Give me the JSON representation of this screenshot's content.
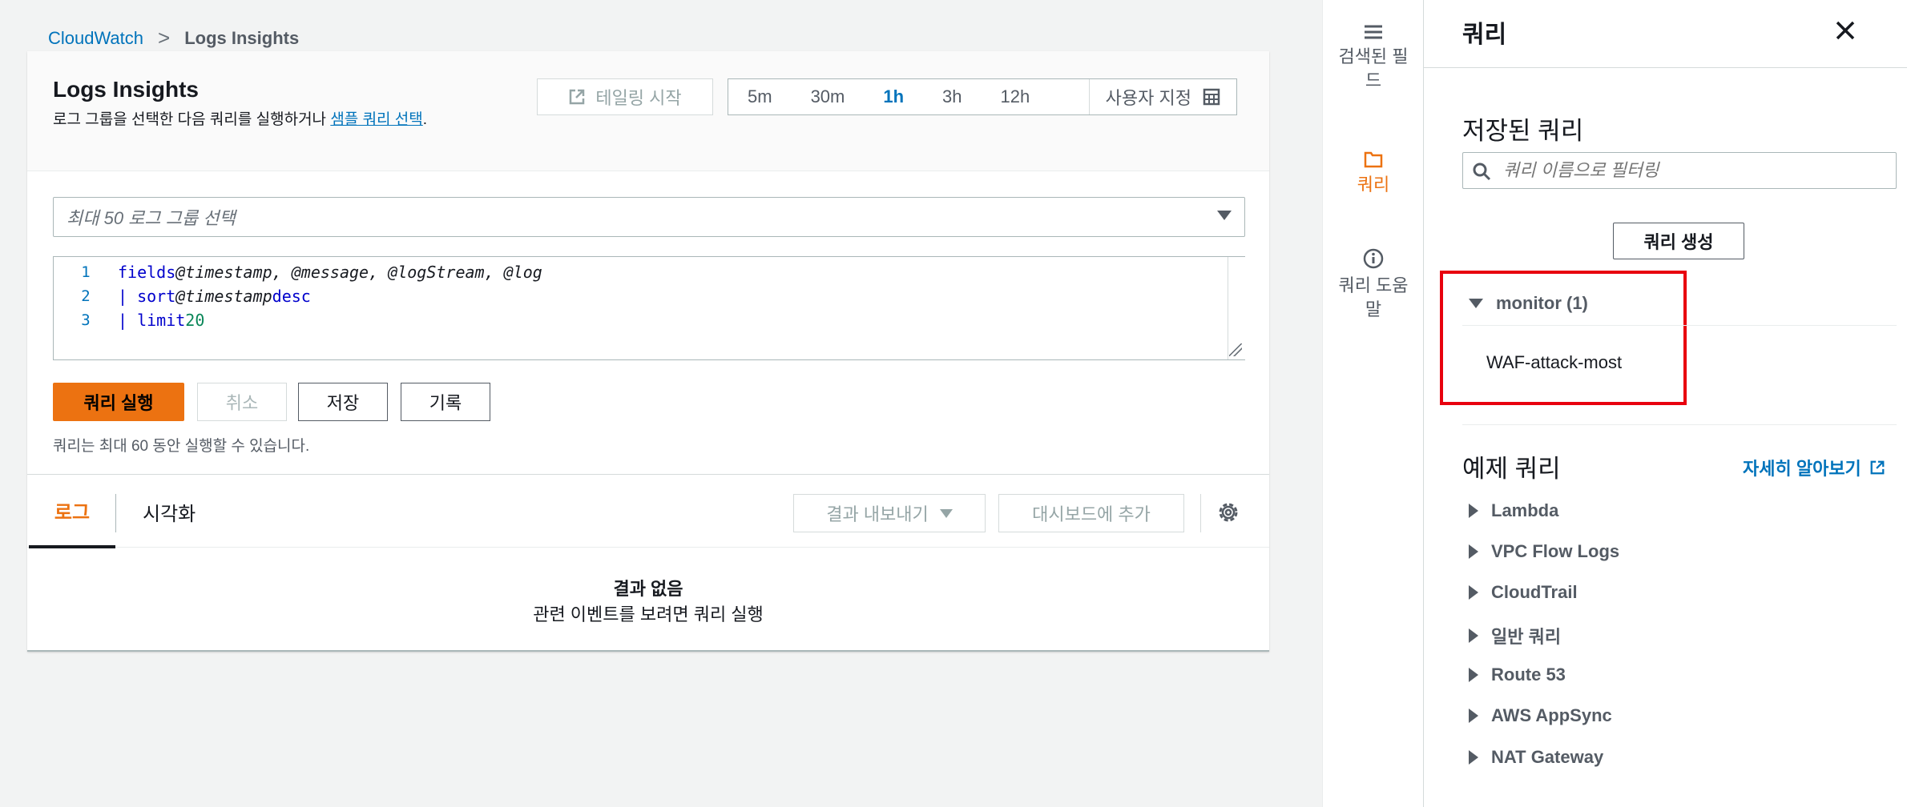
{
  "breadcrumb": {
    "root": "CloudWatch",
    "separator": ">",
    "current": "Logs Insights"
  },
  "header": {
    "title": "Logs Insights",
    "desc_prefix": "로그 그룹을 선택한 다음 쿼리를 실행하거나 ",
    "desc_link": "샘플 쿼리 선택",
    "desc_suffix": ".",
    "tail_label": "테일링 시작",
    "time_ranges": [
      "5m",
      "30m",
      "1h",
      "3h",
      "12h"
    ],
    "active_range": "1h",
    "custom_label": "사용자 지정"
  },
  "log_group_select": {
    "placeholder": "최대 50 로그 그룹 선택"
  },
  "editor": {
    "lines": [
      {
        "no": "1",
        "kw": "fields",
        "text": " @timestamp, @message, @logStream, @log",
        "num": ""
      },
      {
        "no": "2",
        "kw": "| sort",
        "text": " @timestamp ",
        "kw2": "desc",
        "num": ""
      },
      {
        "no": "3",
        "kw": "| limit",
        "text": " ",
        "num": "20"
      }
    ]
  },
  "actions": {
    "run": "쿼리 실행",
    "cancel": "취소",
    "save": "저장",
    "history": "기록",
    "note": "쿼리는 최대 60 동안 실행할 수 있습니다."
  },
  "tabs": {
    "logs": "로그",
    "visualization": "시각화",
    "export": "결과 내보내기",
    "dashboard": "대시보드에 추가"
  },
  "results": {
    "empty_title": "결과 없음",
    "empty_desc": "관련 이벤트를 보려면 쿼리 실행"
  },
  "rail": {
    "fields_line1": "검색된 필",
    "fields_line2": "드",
    "queries": "쿼리",
    "help_line1": "쿼리 도움",
    "help_line2": "말"
  },
  "drawer": {
    "title": "쿼리",
    "saved_title": "저장된 쿼리",
    "filter_placeholder": "쿼리 이름으로 필터링",
    "create_button": "쿼리 생성",
    "folder": "monitor (1)",
    "saved_item": "WAF-attack-most",
    "example_title": "예제 쿼리",
    "learn_more": "자세히 알아보기",
    "examples": [
      "Lambda",
      "VPC Flow Logs",
      "CloudTrail",
      "일반 쿼리",
      "Route 53",
      "AWS AppSync",
      "NAT Gateway"
    ]
  },
  "colors": {
    "accent": "#ec7211",
    "link": "#0073bb",
    "highlight": "#e8000e"
  }
}
